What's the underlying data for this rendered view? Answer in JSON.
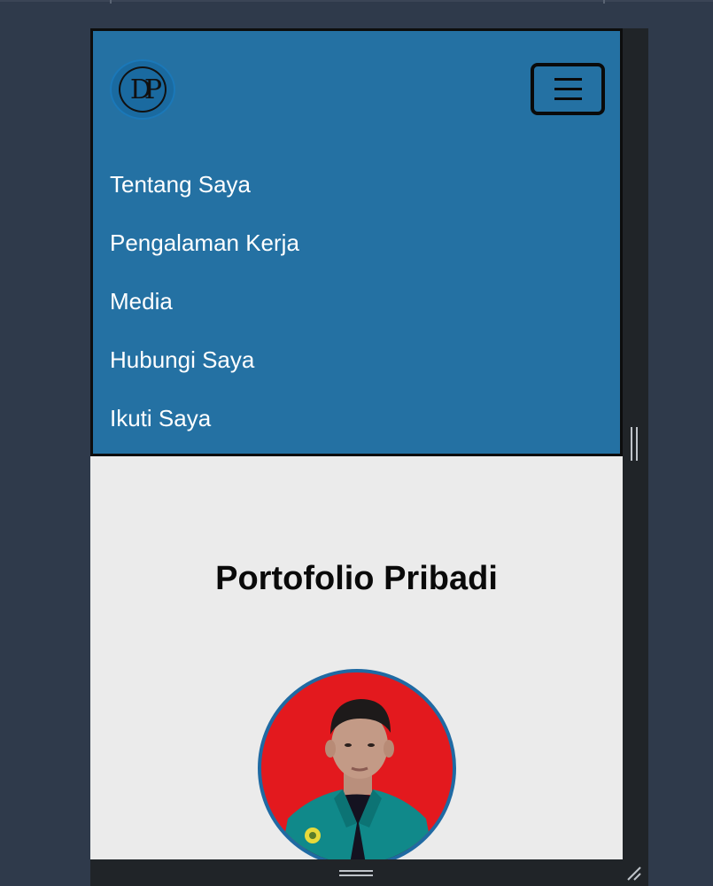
{
  "header": {
    "logo_text": "DP",
    "menu_button_label": "Toggle navigation"
  },
  "nav": {
    "items": [
      {
        "label": "Tentang Saya"
      },
      {
        "label": "Pengalaman Kerja"
      },
      {
        "label": "Media"
      },
      {
        "label": "Hubungi Saya"
      },
      {
        "label": "Ikuti Saya"
      }
    ]
  },
  "hero": {
    "title": "Portofolio Pribadi",
    "avatar_alt": "profile photo"
  },
  "colors": {
    "page_bg": "#2f3a4b",
    "navbar_bg": "#2471a3",
    "content_bg": "#ebebeb",
    "avatar_bg": "#e3191e",
    "avatar_border": "#1f6aa3",
    "jacket": "#10898a"
  },
  "icons": {
    "menu": "hamburger-icon",
    "resize": "resize-handle-icon"
  }
}
